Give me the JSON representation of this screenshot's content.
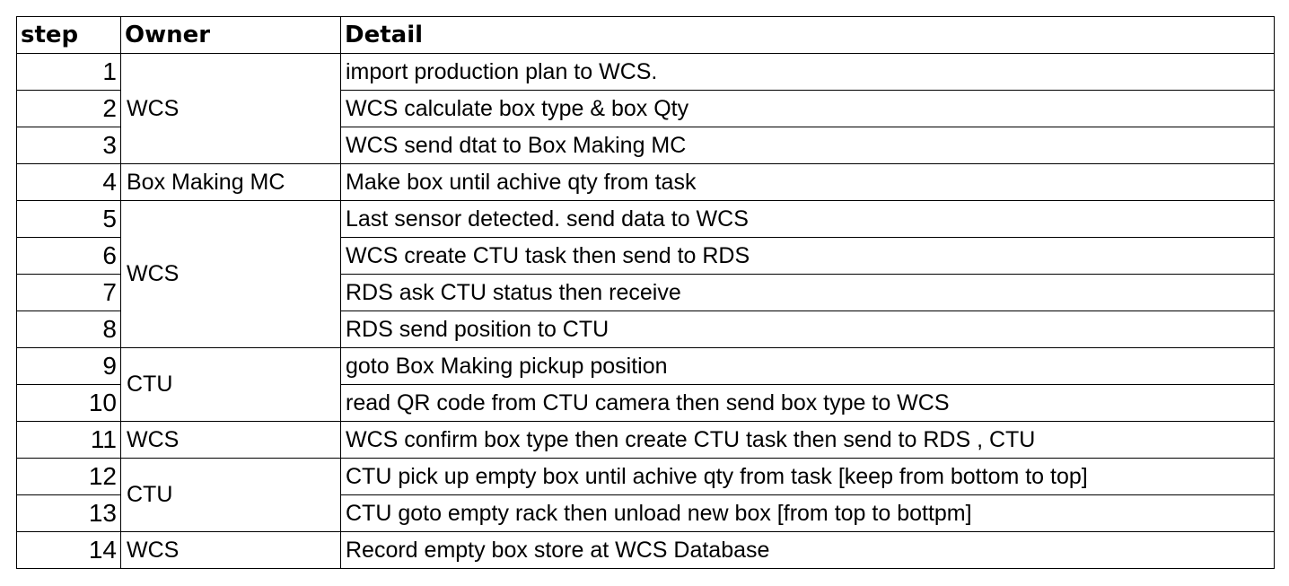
{
  "table": {
    "headers": {
      "step": "step",
      "owner": "Owner",
      "detail": "Detail"
    },
    "owner_groups": [
      {
        "owner": "WCS",
        "rows": 3
      },
      {
        "owner": "Box Making MC",
        "rows": 1
      },
      {
        "owner": "WCS",
        "rows": 4
      },
      {
        "owner": "CTU",
        "rows": 2
      },
      {
        "owner": "WCS",
        "rows": 1
      },
      {
        "owner": "CTU",
        "rows": 2
      },
      {
        "owner": "WCS",
        "rows": 1
      }
    ],
    "rows": [
      {
        "step": "1",
        "detail": "import production plan to WCS."
      },
      {
        "step": "2",
        "detail": "WCS calculate box type & box Qty"
      },
      {
        "step": "3",
        "detail": "WCS send dtat to Box Making MC"
      },
      {
        "step": "4",
        "detail": "Make box until achive qty from task"
      },
      {
        "step": "5",
        "detail": "Last sensor detected. send data to WCS"
      },
      {
        "step": "6",
        "detail": "WCS create CTU task then send to RDS"
      },
      {
        "step": "7",
        "detail": "RDS ask CTU status then receive"
      },
      {
        "step": "8",
        "detail": "RDS send position to CTU"
      },
      {
        "step": "9",
        "detail": "goto Box Making pickup position"
      },
      {
        "step": "10",
        "detail": "read QR code from CTU camera then send box type to WCS"
      },
      {
        "step": "11",
        "detail": "WCS confirm box type then create CTU task then send to RDS , CTU"
      },
      {
        "step": "12",
        "detail": "CTU pick up empty box until achive qty from task [keep from bottom to top]"
      },
      {
        "step": "13",
        "detail": "CTU goto empty rack then unload new box [from top to bottpm]"
      },
      {
        "step": "14",
        "detail": "Record empty box store at WCS Database"
      }
    ]
  }
}
